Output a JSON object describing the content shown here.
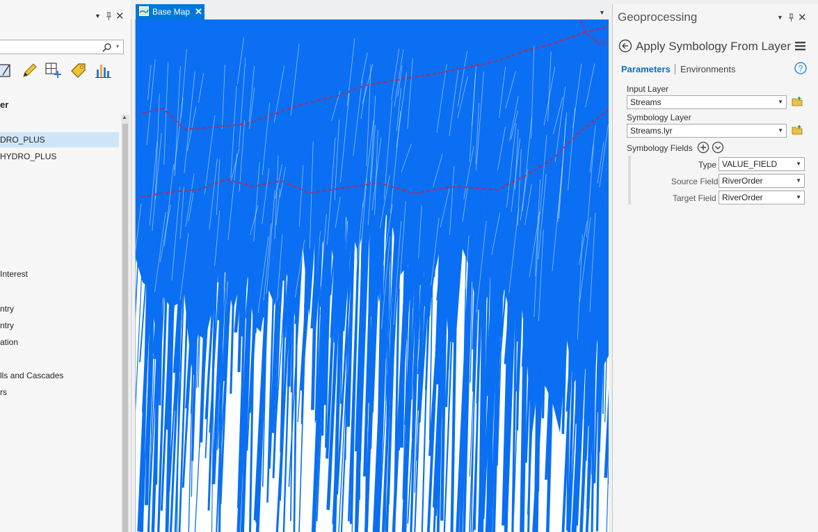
{
  "left_pane": {
    "heading_fragment": "er",
    "tree": [
      {
        "label": "DRO_PLUS",
        "selected": true
      },
      {
        "label": "HYDRO_PLUS",
        "selected": false
      },
      {
        "label": " Interest",
        "selected": false
      },
      {
        "label": "ntry",
        "selected": false
      },
      {
        "label": "ntry",
        "selected": false
      },
      {
        "label": "ation",
        "selected": false
      },
      {
        "label": "lls and Cascades",
        "selected": false
      },
      {
        "label": "rs",
        "selected": false
      }
    ]
  },
  "map_view": {
    "tab_label": "Base Map",
    "colors": {
      "streams": "#0a6ff2",
      "boundary": "#c0254a"
    }
  },
  "geoprocessing": {
    "pane_title": "Geoprocessing",
    "tool_title": "Apply Symbology From Layer",
    "tabs": {
      "active": "Parameters",
      "inactive": "Environments"
    },
    "input_layer": {
      "label": "Input Layer",
      "value": "Streams"
    },
    "symbology_layer": {
      "label": "Symbology Layer",
      "value": "Streams.lyr"
    },
    "symbology_fields": {
      "label": "Symbology Fields",
      "type": {
        "label": "Type",
        "value": "VALUE_FIELD"
      },
      "source_field": {
        "label": "Source Field",
        "value": "RiverOrder"
      },
      "target_field": {
        "label": "Target Field",
        "value": "RiverOrder"
      }
    }
  },
  "colors": {
    "accent": "#0078d7",
    "link": "#0a6fc2"
  }
}
